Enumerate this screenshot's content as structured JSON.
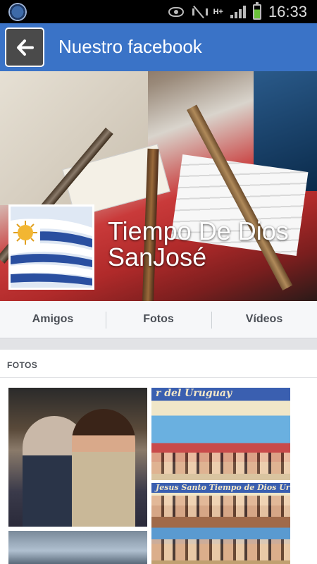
{
  "status_bar": {
    "time": "16:33",
    "network": "H+",
    "icons": [
      "app-badge-icon",
      "eye-icon",
      "mute-icon",
      "signal-icon",
      "battery-icon"
    ]
  },
  "app_bar": {
    "title": "Nuestro facebook",
    "back_icon": "arrow-left-icon"
  },
  "cover": {
    "page_name": "Tiempo De Dios SanJosé"
  },
  "tabs": [
    {
      "label": "Amigos"
    },
    {
      "label": "Fotos"
    },
    {
      "label": "Vídeos"
    }
  ],
  "photos_section": {
    "title": "FOTOS",
    "collage_titles": [
      "r del Uruguay",
      "Jesus Santo Tiempo de Dios Uruguay"
    ]
  },
  "colors": {
    "app_bar": "#3a73c7",
    "status_bar": "#000000",
    "tab_bar": "#f6f7f9"
  }
}
